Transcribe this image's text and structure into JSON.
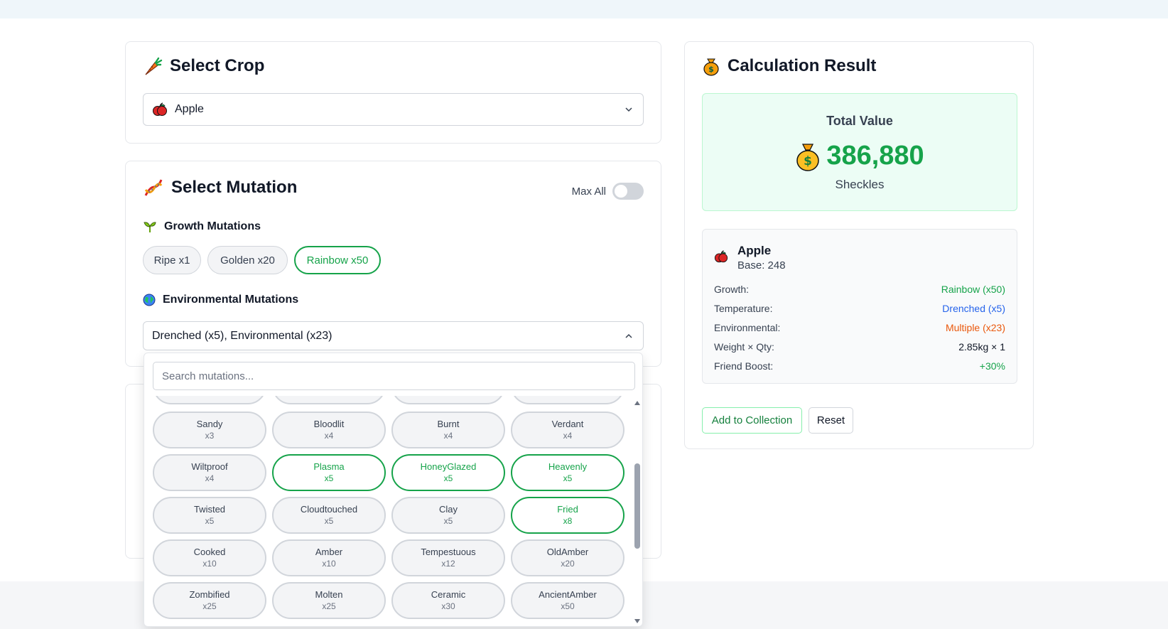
{
  "crop_card": {
    "title": "Select Crop",
    "title_icon": "carrot-icon",
    "selected": "Apple",
    "selected_icon": "apple-icon"
  },
  "mutation_card": {
    "title": "Select Mutation",
    "title_icon": "dna-icon",
    "max_all_label": "Max All",
    "max_all_on": false,
    "growth_heading": "Growth Mutations",
    "growth_options": [
      {
        "label": "Ripe x1",
        "active": false
      },
      {
        "label": "Golden x20",
        "active": false
      },
      {
        "label": "Rainbow x50",
        "active": true
      }
    ],
    "env_heading": "Environmental Mutations",
    "env_selected": "Drenched (x5), Environmental (x23)",
    "search_placeholder": "Search mutations...",
    "env_options": [
      {
        "name": "Sandy",
        "mult": "x3",
        "active": false
      },
      {
        "name": "Bloodlit",
        "mult": "x4",
        "active": false
      },
      {
        "name": "Burnt",
        "mult": "x4",
        "active": false
      },
      {
        "name": "Verdant",
        "mult": "x4",
        "active": false
      },
      {
        "name": "Wiltproof",
        "mult": "x4",
        "active": false
      },
      {
        "name": "Plasma",
        "mult": "x5",
        "active": true
      },
      {
        "name": "HoneyGlazed",
        "mult": "x5",
        "active": true
      },
      {
        "name": "Heavenly",
        "mult": "x5",
        "active": true
      },
      {
        "name": "Twisted",
        "mult": "x5",
        "active": false
      },
      {
        "name": "Cloudtouched",
        "mult": "x5",
        "active": false
      },
      {
        "name": "Clay",
        "mult": "x5",
        "active": false
      },
      {
        "name": "Fried",
        "mult": "x8",
        "active": true
      },
      {
        "name": "Cooked",
        "mult": "x10",
        "active": false
      },
      {
        "name": "Amber",
        "mult": "x10",
        "active": false
      },
      {
        "name": "Tempestuous",
        "mult": "x12",
        "active": false
      },
      {
        "name": "OldAmber",
        "mult": "x20",
        "active": false
      },
      {
        "name": "Zombified",
        "mult": "x25",
        "active": false
      },
      {
        "name": "Molten",
        "mult": "x25",
        "active": false
      },
      {
        "name": "Ceramic",
        "mult": "x30",
        "active": false
      },
      {
        "name": "AncientAmber",
        "mult": "x50",
        "active": false
      }
    ]
  },
  "result_card": {
    "title": "Calculation Result",
    "title_icon": "money-bag-icon",
    "total_label": "Total Value",
    "total_value": "386,880",
    "total_unit": "Sheckles",
    "crop_name": "Apple",
    "crop_base": "Base: 248",
    "rows": [
      {
        "label": "Growth:",
        "value": "Rainbow (x50)",
        "color": "#16a34a"
      },
      {
        "label": "Temperature:",
        "value": "Drenched (x5)",
        "color": "#2563eb"
      },
      {
        "label": "Environmental:",
        "value": "Multiple (x23)",
        "color": "#ea580c"
      },
      {
        "label": "Weight × Qty:",
        "value": "2.85kg × 1",
        "color": "#111827"
      },
      {
        "label": "Friend Boost:",
        "value": "+30%",
        "color": "#16a34a"
      }
    ],
    "add_button": "Add to Collection",
    "reset_button": "Reset"
  }
}
